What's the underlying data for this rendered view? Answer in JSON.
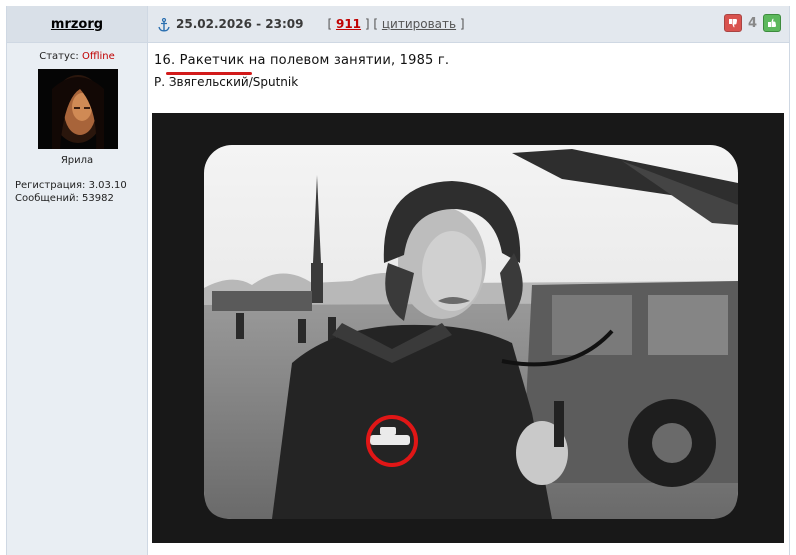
{
  "post": {
    "author": "mrzorg",
    "date": "25.02.2026 - 23:09",
    "bracket_open": "[",
    "bracket_sep": "] [",
    "bracket_close": "]",
    "post_number": "911",
    "quote_label": "цитировать",
    "rating": "4"
  },
  "user": {
    "status_label": "Статус:",
    "status_value": "Offline",
    "title": "Ярила",
    "registration": "Регистрация: 3.03.10",
    "messages": "Сообщений: 53982"
  },
  "content": {
    "caption_number": "16.",
    "caption_highlight": "Ракетчик",
    "caption_rest": "на полевом занятии, 1985 г.",
    "credit": "Р. Звягельский/Sputnik"
  },
  "colors": {
    "header_bg": "#e3e8ee",
    "sidebar_bg": "#e9eef3",
    "offline": "#c00000",
    "post_number": "#c00000",
    "annotation_red": "#d21a1a"
  },
  "icons": {
    "anchor": "anchor-icon",
    "thumb_down": "thumb-down-icon",
    "thumb_up": "thumb-up-icon"
  }
}
